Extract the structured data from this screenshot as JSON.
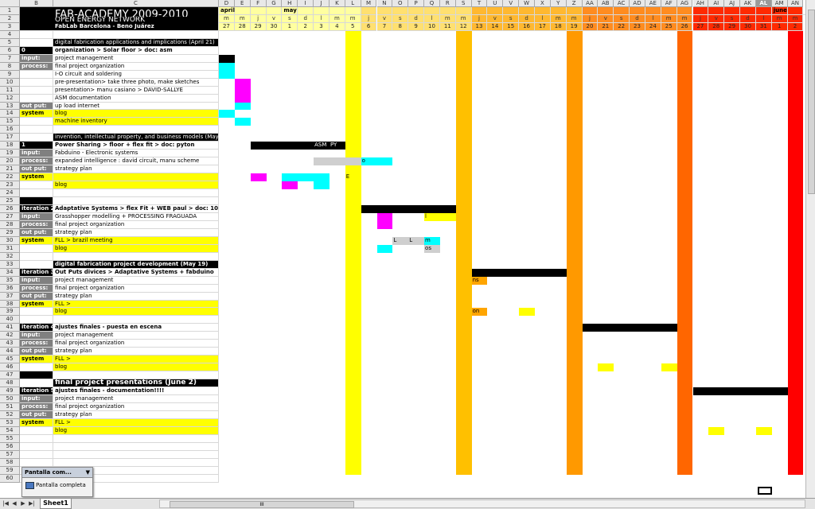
{
  "columns": [
    "B",
    "C",
    "D",
    "E",
    "F",
    "G",
    "H",
    "I",
    "J",
    "K",
    "L",
    "M",
    "N",
    "O",
    "P",
    "Q",
    "R",
    "S",
    "T",
    "U",
    "V",
    "W",
    "X",
    "Y",
    "Z",
    "AA",
    "AB",
    "AC",
    "AD",
    "AE",
    "AF",
    "AG",
    "AH",
    "AI",
    "AJ",
    "AK",
    "AL",
    "AM",
    "AN"
  ],
  "selected_column": "AL",
  "title": {
    "main": "FAB-ACADEMY 2009-2010",
    "sub": "OPEN ENERGY NETWORK",
    "author": "FabLab Barcelona - Beno Juárez"
  },
  "months": [
    {
      "col": "D",
      "label": "april"
    },
    {
      "col": "H",
      "label": "may"
    },
    {
      "col": "AM",
      "label": "june"
    }
  ],
  "weekdays": [
    "m",
    "m",
    "j",
    "v",
    "s",
    "d",
    "l",
    "m",
    "m",
    "j",
    "v",
    "s",
    "d",
    "l",
    "m",
    "m",
    "j",
    "v",
    "s",
    "d",
    "l",
    "m",
    "m",
    "j",
    "v",
    "s",
    "d",
    "l",
    "m",
    "m",
    "j",
    "v",
    "s",
    "d",
    "l",
    "m",
    "m"
  ],
  "dates": [
    "27",
    "28",
    "29",
    "30",
    "1",
    "2",
    "3",
    "4",
    "5",
    "6",
    "7",
    "8",
    "9",
    "10",
    "11",
    "12",
    "13",
    "14",
    "15",
    "16",
    "17",
    "18",
    "19",
    "20",
    "21",
    "22",
    "23",
    "24",
    "25",
    "26",
    "27",
    "28",
    "29",
    "30",
    "31",
    "1",
    "2"
  ],
  "colors": {
    "highlight_yellow": "#ffff00",
    "black_bar": "#000000",
    "cyan": "#00ffff",
    "magenta": "#ff00ff",
    "orange": "#ffa500",
    "red": "#ff0000",
    "column_L": "#ffff00",
    "column_S": "#ffc000",
    "column_Z": "#ff9900",
    "column_AG": "#ff6600",
    "column_AN": "#ff0000"
  },
  "rows": [
    {
      "n": "1",
      "b": "",
      "c": ""
    },
    {
      "n": "2",
      "b": "",
      "c": ""
    },
    {
      "n": "3",
      "b": "",
      "c": ""
    },
    {
      "n": "4",
      "b": "",
      "c": ""
    },
    {
      "n": "5",
      "b": "",
      "c": "digital fabrication applications and implications (April 21)"
    },
    {
      "n": "6",
      "b": "0",
      "c": "organization > Solar floor > doc: asm"
    },
    {
      "n": "7",
      "b": "input:",
      "c": " project management"
    },
    {
      "n": "8",
      "b": "process:",
      "c": "final project organization"
    },
    {
      "n": "9",
      "b": "",
      "c": "I-O circuit and soldering"
    },
    {
      "n": "10",
      "b": "",
      "c": "pre-presentation> take three photo, make sketches"
    },
    {
      "n": "11",
      "b": "",
      "c": "presentation> manu casiano > DAVID-SALLYE"
    },
    {
      "n": "12",
      "b": "",
      "c": "ASM documentation"
    },
    {
      "n": "13",
      "b": "out put:",
      "c": "up load internet"
    },
    {
      "n": "14",
      "b": "system",
      "c": "blog"
    },
    {
      "n": "15",
      "b": "",
      "c": "machine inventory"
    },
    {
      "n": "16",
      "b": "",
      "c": ""
    },
    {
      "n": "17",
      "b": "",
      "c": "invention, intellectual property, and business models (May 5)"
    },
    {
      "n": "18",
      "b": "1",
      "c": "Power Sharing > floor + flex fit > doc: pyton"
    },
    {
      "n": "19",
      "b": "input:",
      "c": "Fabduino - Electronic systems"
    },
    {
      "n": "20",
      "b": "process:",
      "c": "expanded intelligence : david circuit, manu scheme"
    },
    {
      "n": "21",
      "b": "out put:",
      "c": "strategy plan"
    },
    {
      "n": "22",
      "b": "system",
      "c": ""
    },
    {
      "n": "23",
      "b": "",
      "c": "blog"
    },
    {
      "n": "24",
      "b": "",
      "c": ""
    },
    {
      "n": "25",
      "b": "",
      "c": ""
    },
    {
      "n": "26",
      "b": "iteration 2",
      "c": "Adaptative Systems > flex Fit +  WEB paul  > doc: 10"
    },
    {
      "n": "27",
      "b": "input:",
      "c": "Grasshopper modelling + PROCESSING FRAGUADA"
    },
    {
      "n": "28",
      "b": "process:",
      "c": "final project organization"
    },
    {
      "n": "29",
      "b": "out put:",
      "c": "strategy plan"
    },
    {
      "n": "30",
      "b": "system",
      "c": "FLL > brazil meeting"
    },
    {
      "n": "31",
      "b": "",
      "c": "blog"
    },
    {
      "n": "32",
      "b": "",
      "c": ""
    },
    {
      "n": "33",
      "b": "",
      "c": "digital fabrication project development (May 19)"
    },
    {
      "n": "34",
      "b": "iteration 3",
      "c": "Out Puts divices > Adaptative Systems + fabduino"
    },
    {
      "n": "35",
      "b": "input:",
      "c": " project management"
    },
    {
      "n": "36",
      "b": "process:",
      "c": "final project organization"
    },
    {
      "n": "37",
      "b": "out put:",
      "c": "strategy plan"
    },
    {
      "n": "38",
      "b": "system",
      "c": "FLL >"
    },
    {
      "n": "39",
      "b": "",
      "c": "blog"
    },
    {
      "n": "40",
      "b": "",
      "c": ""
    },
    {
      "n": "41",
      "b": "iteration 4",
      "c": "ajustes finales - puesta en escena"
    },
    {
      "n": "42",
      "b": "input:",
      "c": " project management"
    },
    {
      "n": "43",
      "b": "process:",
      "c": "final project organization"
    },
    {
      "n": "44",
      "b": "out put:",
      "c": "strategy plan"
    },
    {
      "n": "45",
      "b": "system",
      "c": "FLL >"
    },
    {
      "n": "46",
      "b": "",
      "c": "blog"
    },
    {
      "n": "47",
      "b": "",
      "c": ""
    },
    {
      "n": "48",
      "b": "",
      "c": "final project presentations (June 2)"
    },
    {
      "n": "49",
      "b": "iteration 5",
      "c": "ajustes finales - documentation!!!!"
    },
    {
      "n": "50",
      "b": "input:",
      "c": " project management"
    },
    {
      "n": "51",
      "b": "process:",
      "c": "final project organization"
    },
    {
      "n": "52",
      "b": "out put:",
      "c": "strategy plan"
    },
    {
      "n": "53",
      "b": "system",
      "c": "FLL >"
    },
    {
      "n": "54",
      "b": "",
      "c": "blog"
    },
    {
      "n": "55",
      "b": "",
      "c": ""
    },
    {
      "n": "56",
      "b": "",
      "c": ""
    },
    {
      "n": "57",
      "b": "",
      "c": ""
    },
    {
      "n": "58",
      "b": "",
      "c": ""
    },
    {
      "n": "59",
      "b": "",
      "c": ""
    },
    {
      "n": "60",
      "b": "",
      "c": ""
    }
  ],
  "timeline_labels": [
    {
      "row": "18",
      "col": "J",
      "text": "ASM"
    },
    {
      "row": "18",
      "col": "K",
      "text": "PY"
    },
    {
      "row": "20",
      "col": "M",
      "text": "o"
    },
    {
      "row": "22",
      "col": "L",
      "text": "E"
    },
    {
      "row": "30",
      "col": "O",
      "text": "L"
    },
    {
      "row": "30",
      "col": "P",
      "text": "L"
    },
    {
      "row": "30",
      "col": "Q",
      "text": "m"
    },
    {
      "row": "31",
      "col": "Q",
      "text": "os"
    },
    {
      "row": "35",
      "col": "T",
      "text": "ns"
    },
    {
      "row": "39",
      "col": "T",
      "text": "on"
    },
    {
      "row": "27",
      "col": "Q",
      "text": "l"
    }
  ],
  "sheet_tab": "Sheet1",
  "popup": {
    "title": "Pantalla com...",
    "item": "Pantalla completa"
  },
  "hscroll_label": "III"
}
